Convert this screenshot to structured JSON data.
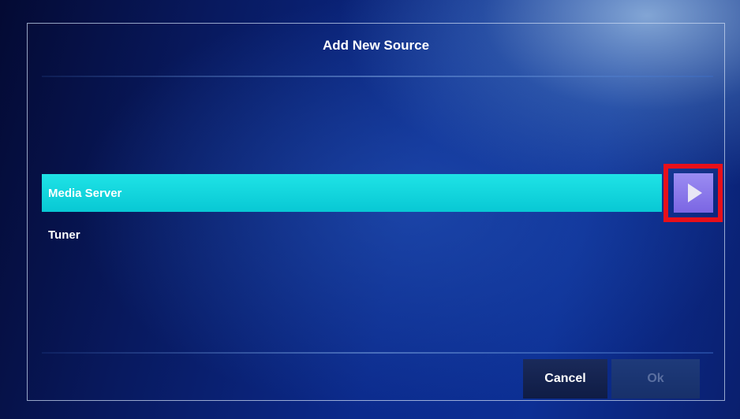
{
  "dialog": {
    "title": "Add New Source"
  },
  "list": {
    "items": [
      {
        "label": "Media Server",
        "selected": true
      },
      {
        "label": "Tuner",
        "selected": false
      }
    ]
  },
  "arrow_button": {
    "icon": "play-arrow-icon",
    "highlight_color": "#e8101a",
    "button_color": "#8a78ec"
  },
  "buttons": {
    "cancel_label": "Cancel",
    "ok_label": "Ok",
    "ok_enabled": false
  },
  "colors": {
    "selected_row": "#10d6dc",
    "background": "#0b2a8c"
  }
}
